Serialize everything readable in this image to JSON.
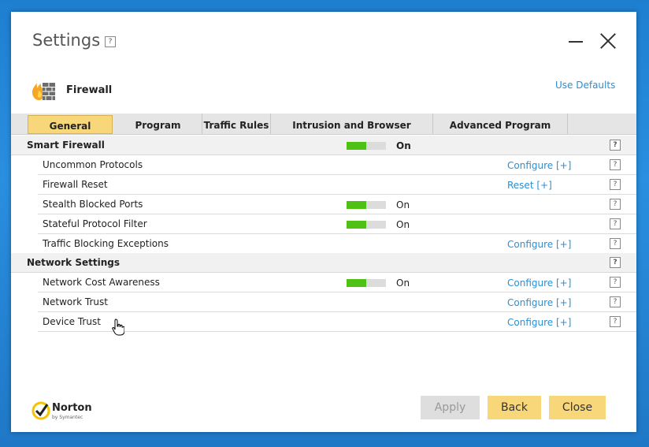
{
  "window": {
    "title": "Settings",
    "title_help": "?"
  },
  "header": {
    "feature_name": "Firewall",
    "use_defaults": "Use Defaults"
  },
  "tabs": [
    {
      "label": "General Settings",
      "active": true
    },
    {
      "label": "Program Control",
      "active": false
    },
    {
      "label": "Traffic Rules",
      "active": false
    },
    {
      "label": "Intrusion and Browser Protection",
      "active": false
    },
    {
      "label": "Advanced Program Control",
      "active": false
    }
  ],
  "sections": {
    "smart_firewall": {
      "label": "Smart Firewall",
      "toggle_state": "On",
      "toggle_level": 0.5,
      "help": "?",
      "rows": [
        {
          "label": "Uncommon Protocols",
          "action": "Configure [+]",
          "help": "?"
        },
        {
          "label": "Firewall Reset",
          "action": "Reset [+]",
          "help": "?"
        },
        {
          "label": "Stealth Blocked Ports",
          "toggle_state": "On",
          "help": "?"
        },
        {
          "label": "Stateful Protocol Filter",
          "toggle_state": "On",
          "help": "?"
        },
        {
          "label": "Traffic Blocking Exceptions",
          "action": "Configure [+]",
          "help": "?"
        }
      ]
    },
    "network_settings": {
      "label": "Network Settings",
      "help": "?",
      "rows": [
        {
          "label": "Network Cost Awareness",
          "toggle_state": "On",
          "action": "Configure [+]",
          "help": "?"
        },
        {
          "label": "Network Trust",
          "action": "Configure [+]",
          "help": "?"
        },
        {
          "label": "Device Trust",
          "action": "Configure [+]",
          "help": "?"
        }
      ]
    }
  },
  "footer": {
    "brand": "Norton",
    "brand_sub": "by Symantec",
    "apply": "Apply",
    "back": "Back",
    "close": "Close"
  },
  "colors": {
    "accent_yellow": "#f7d77a",
    "toggle_on": "#4fc114",
    "link_blue": "#2a8fd4"
  }
}
